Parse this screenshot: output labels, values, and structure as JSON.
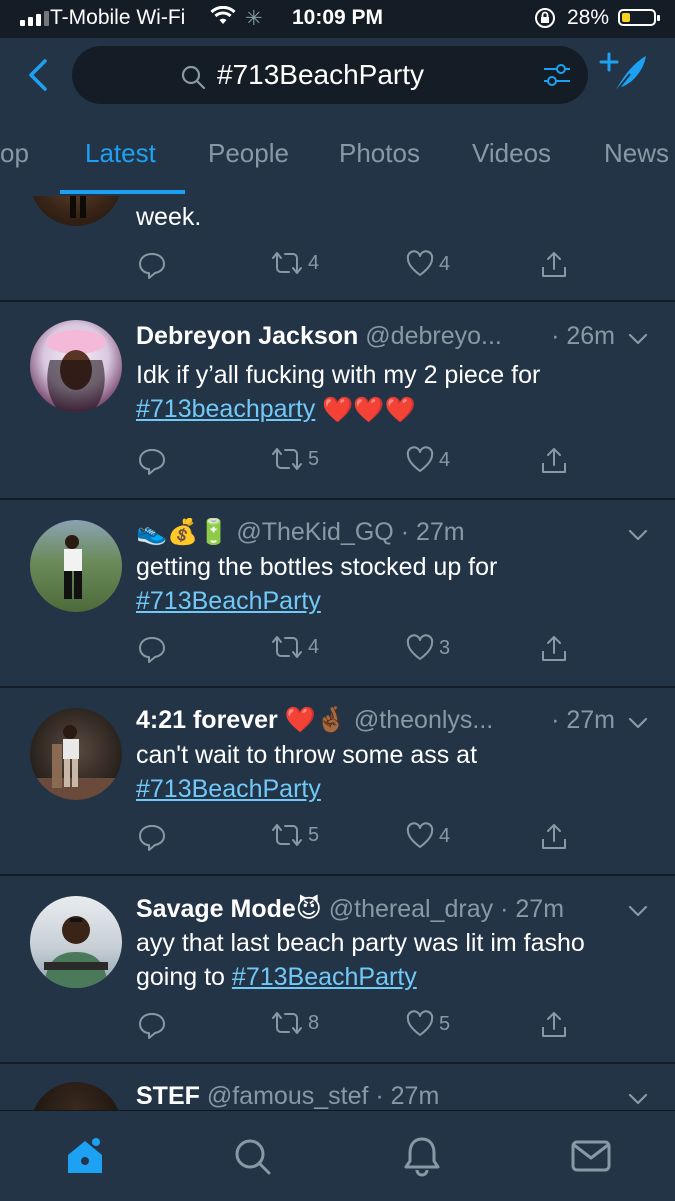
{
  "status_bar": {
    "carrier": "T-Mobile Wi-Fi",
    "time": "10:09 PM",
    "battery": "28%",
    "battery_level": 0.28
  },
  "search": {
    "query": "#713BeachParty"
  },
  "tabs": [
    {
      "label": "Top",
      "visible_text": "op",
      "active": false
    },
    {
      "label": "Latest",
      "active": true
    },
    {
      "label": "People",
      "active": false
    },
    {
      "label": "Photos",
      "active": false
    },
    {
      "label": "Videos",
      "active": false
    },
    {
      "label": "News",
      "active": false
    }
  ],
  "tweets": [
    {
      "name": "",
      "handle": "",
      "time": "",
      "text_lines": [
        "week."
      ],
      "hashtag": "",
      "retweets": "4",
      "likes": "4"
    },
    {
      "name": "Debreyon Jackson",
      "handle": "@debreyo...",
      "time": "· 26m",
      "text_before": "Idk if y’all fucking with my 2 piece for",
      "hashtag": "#713beachparty",
      "text_after": "❤️❤️❤️",
      "retweets": "5",
      "likes": "4"
    },
    {
      "name": "👟💰🔋",
      "handle": "@TheKid_GQ",
      "time": "· 27m",
      "text_before": "getting the bottles stocked up for",
      "hashtag": "#713BeachParty",
      "text_after": "",
      "retweets": "4",
      "likes": "3"
    },
    {
      "name": "4:21 forever ❤️🤞🏾",
      "handle": "@theonlys...",
      "time": "· 27m",
      "text_before": "can't wait to throw some ass at",
      "hashtag": "#713BeachParty",
      "text_after": "",
      "retweets": "5",
      "likes": "4"
    },
    {
      "name": "Savage Mode😈",
      "handle": "@thereal_dray",
      "time": "· 27m",
      "text_before": "ayy that last beach party was lit im fasho going to",
      "hashtag": "#713BeachParty",
      "text_after": "",
      "retweets": "8",
      "likes": "5"
    },
    {
      "name": "STEF",
      "handle": "@famous_stef",
      "time": "· 27m"
    }
  ],
  "colors": {
    "accent": "#1da1f2",
    "background": "#243447",
    "hashtag": "#71c9f8"
  },
  "icons": [
    "back-icon",
    "search-icon",
    "filter-icon",
    "compose-icon",
    "reply-icon",
    "retweet-icon",
    "like-icon",
    "share-icon",
    "caret-icon",
    "home-icon",
    "explore-icon",
    "notifications-icon",
    "messages-icon"
  ]
}
